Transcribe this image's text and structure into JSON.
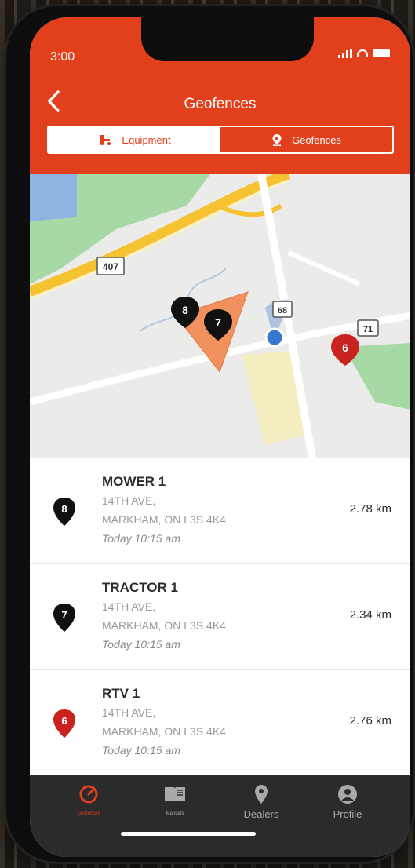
{
  "status": {
    "time": "3:00"
  },
  "header": {
    "title": "Geofences",
    "back_icon": "chevron-left-icon"
  },
  "tabs": [
    {
      "label": "Equipment",
      "icon": "tractor-icon",
      "active": true
    },
    {
      "label": "Geofences",
      "icon": "map-pin-icon",
      "active": false
    }
  ],
  "map": {
    "highway_labels": [
      "407",
      "68",
      "71"
    ],
    "pins": [
      {
        "label": "8",
        "color": "#111111"
      },
      {
        "label": "7",
        "color": "#111111"
      },
      {
        "label": "6",
        "color": "#c8231f"
      }
    ],
    "geofence_color": "#f0915e",
    "location_dot_color": "#3a78d0"
  },
  "equipment": [
    {
      "pin": "8",
      "pin_color": "#111111",
      "name": "MOWER 1",
      "addr1": "14TH AVE,",
      "addr2": "MARKHAM, ON L3S 4K4",
      "time": "Today 10:15 am",
      "distance": "2.78 km"
    },
    {
      "pin": "7",
      "pin_color": "#111111",
      "name": "TRACTOR 1",
      "addr1": "14TH AVE,",
      "addr2": "MARKHAM, ON L3S 4K4",
      "time": "Today 10:15 am",
      "distance": "2.34 km"
    },
    {
      "pin": "6",
      "pin_color": "#c8231f",
      "name": "RTV 1",
      "addr1": "14TH AVE,",
      "addr2": "MARKHAM, ON L3S 4K4",
      "time": "Today 10:15 am",
      "distance": "2.76 km"
    }
  ],
  "tabbar": [
    {
      "label": "Geofences",
      "icon": "gauge-icon",
      "active": true
    },
    {
      "label": "Manuals",
      "icon": "book-icon",
      "active": false
    },
    {
      "label": "Dealers",
      "icon": "location-pin-icon",
      "active": false
    },
    {
      "label": "Profile",
      "icon": "user-icon",
      "active": false
    }
  ],
  "colors": {
    "brand": "#e2401c",
    "tabbar_bg": "#2b2b2b",
    "active_tab": "#e2401c"
  }
}
